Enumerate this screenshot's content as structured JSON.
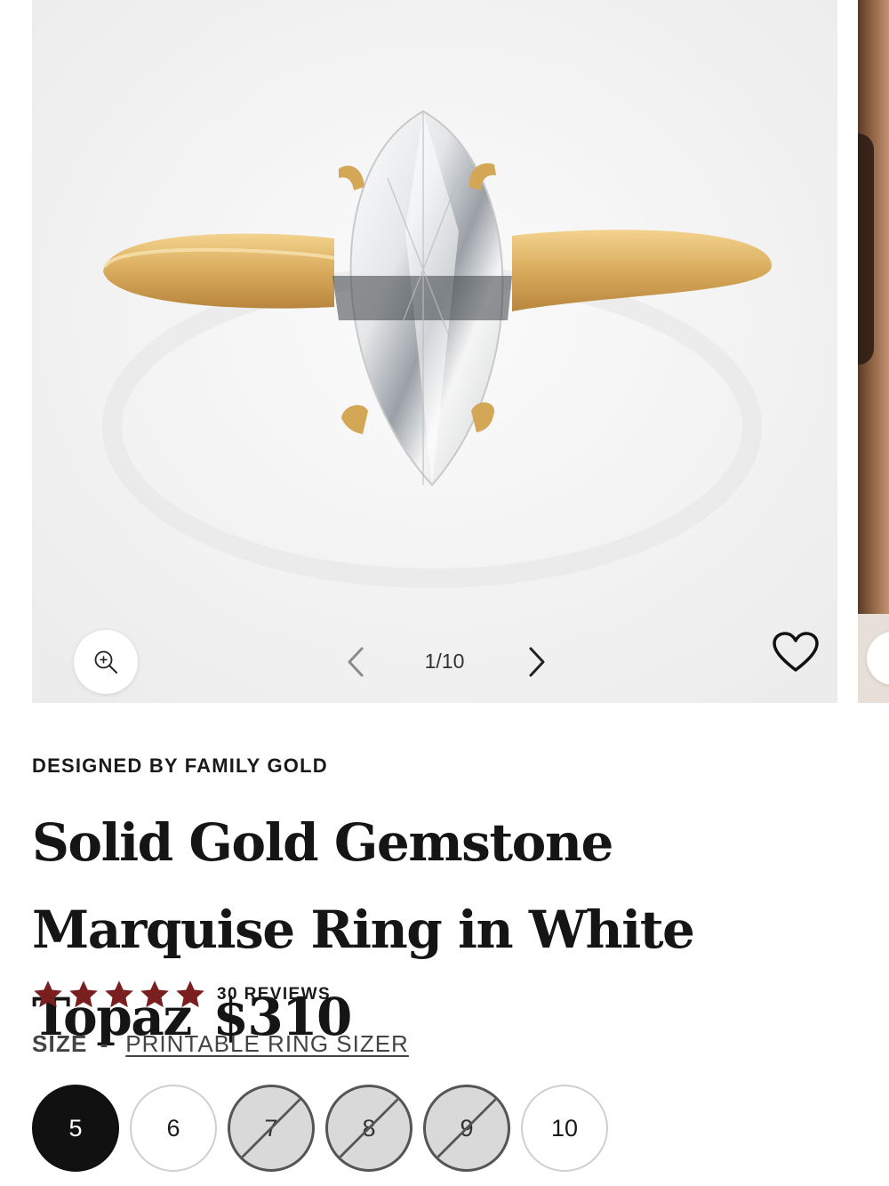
{
  "gallery": {
    "counter": "1/10",
    "image_alt": "Solid Gold Gemstone Marquise Ring in White Topaz"
  },
  "product": {
    "designer": "DESIGNED BY FAMILY GOLD",
    "title": "Solid Gold Gemstone Marquise Ring in White Topaz",
    "price": "$310",
    "rating": 5,
    "reviews": "30 REVIEWS"
  },
  "size": {
    "label": "SIZE",
    "separator": "-",
    "sizer_link": "PRINTABLE RING SIZER",
    "options": [
      {
        "label": "5",
        "state": "selected"
      },
      {
        "label": "6",
        "state": "available"
      },
      {
        "label": "7",
        "state": "unavailable"
      },
      {
        "label": "8",
        "state": "unavailable"
      },
      {
        "label": "9",
        "state": "unavailable"
      },
      {
        "label": "10",
        "state": "available"
      }
    ]
  },
  "colors": {
    "star": "#7a1f1f",
    "selected_size_bg": "#111111",
    "unavailable_size_bg": "#d9d9d9",
    "gold": "#d4a757"
  },
  "icons": {
    "zoom": "zoom-in-icon",
    "prev": "chevron-left-icon",
    "next": "chevron-right-icon",
    "wishlist": "heart-icon",
    "star": "star-icon"
  }
}
